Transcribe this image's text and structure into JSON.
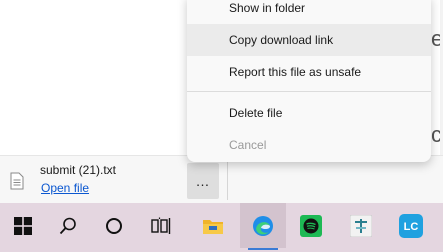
{
  "page": {
    "partial_text_1": "es",
    "partial_text_2": "co"
  },
  "download": {
    "file_name": "submit (21).txt",
    "open_label": "Open file",
    "more_label": "…"
  },
  "menu": {
    "items": [
      {
        "label": "Show in folder",
        "state": "normal"
      },
      {
        "label": "Copy download link",
        "state": "hover"
      },
      {
        "label": "Report this file as unsafe",
        "state": "normal"
      },
      {
        "label": "Delete file",
        "state": "normal"
      },
      {
        "label": "Cancel",
        "state": "disabled"
      }
    ]
  },
  "taskbar": {
    "background": "#e4d6e0",
    "items": [
      {
        "name": "windows-start-icon"
      },
      {
        "name": "search-icon"
      },
      {
        "name": "cortana-icon"
      },
      {
        "name": "task-view-icon"
      },
      {
        "name": "file-explorer-icon"
      },
      {
        "name": "edge-icon",
        "active": true
      },
      {
        "name": "spotify-icon"
      },
      {
        "name": "app-icon"
      },
      {
        "name": "lc-app-icon",
        "label": "LC"
      }
    ]
  }
}
